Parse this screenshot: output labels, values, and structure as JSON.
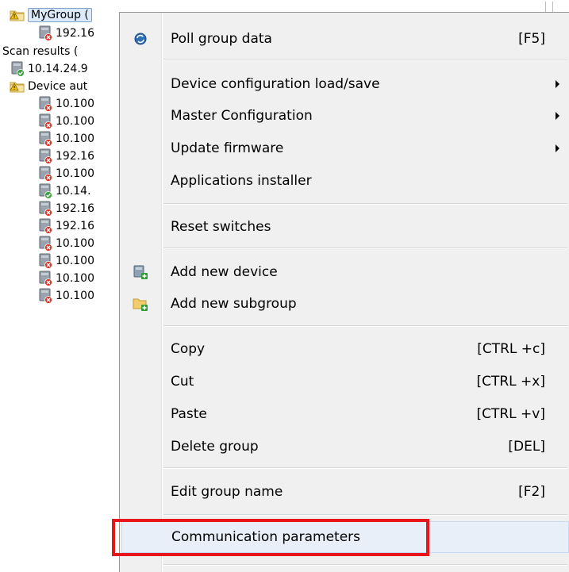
{
  "tree": {
    "items": [
      {
        "label": "MyGroup (",
        "icon": "folder-warning-icon",
        "indent": 0,
        "selected": true
      },
      {
        "label": "192.16",
        "icon": "device-error-icon",
        "indent": 1
      },
      {
        "label": "Scan results (",
        "icon": "",
        "indent": 0
      },
      {
        "label": "10.14.24.9",
        "icon": "device-ok-icon",
        "indent": 0
      },
      {
        "label": "Device aut",
        "icon": "folder-warning-icon",
        "indent": 0
      },
      {
        "label": "10.100",
        "icon": "device-error-icon",
        "indent": 1
      },
      {
        "label": "10.100",
        "icon": "device-error-icon",
        "indent": 1
      },
      {
        "label": "10.100",
        "icon": "device-error-icon",
        "indent": 1
      },
      {
        "label": "192.16",
        "icon": "device-error-icon",
        "indent": 1
      },
      {
        "label": "10.100",
        "icon": "device-error-icon",
        "indent": 1
      },
      {
        "label": "10.14.",
        "icon": "device-ok-icon",
        "indent": 1
      },
      {
        "label": "192.16",
        "icon": "device-error-icon",
        "indent": 1
      },
      {
        "label": "192.16",
        "icon": "device-error-icon",
        "indent": 1
      },
      {
        "label": "10.100",
        "icon": "device-error-icon",
        "indent": 1
      },
      {
        "label": "10.100",
        "icon": "device-error-icon",
        "indent": 1
      },
      {
        "label": "10.100",
        "icon": "device-error-icon",
        "indent": 1
      },
      {
        "label": "10.100",
        "icon": "device-error-icon",
        "indent": 1
      }
    ]
  },
  "menu": {
    "items": [
      {
        "label": "Poll group data",
        "shortcut": "[F5]",
        "icon": "poll-icon"
      },
      {
        "label": "Device configuration load/save",
        "submenu": true
      },
      {
        "label": "Master Configuration",
        "submenu": true
      },
      {
        "label": "Update firmware",
        "submenu": true
      },
      {
        "label": "Applications installer"
      },
      {
        "label": "Reset switches"
      },
      {
        "label": "Add new device",
        "icon": "add-device-icon"
      },
      {
        "label": "Add new subgroup",
        "icon": "add-subgroup-icon"
      },
      {
        "label": "Copy",
        "shortcut": "[CTRL +c]"
      },
      {
        "label": "Cut",
        "shortcut": "[CTRL +x]"
      },
      {
        "label": "Paste",
        "shortcut": "[CTRL +v]"
      },
      {
        "label": "Delete group",
        "shortcut": "[DEL]"
      },
      {
        "label": "Edit group name",
        "shortcut": "[F2]"
      },
      {
        "label": "Communication parameters",
        "highlighted": true
      }
    ]
  },
  "colors": {
    "highlight_border": "#e8161b",
    "menu_background": "#f0f0f0",
    "selection": "#dcebfc"
  }
}
